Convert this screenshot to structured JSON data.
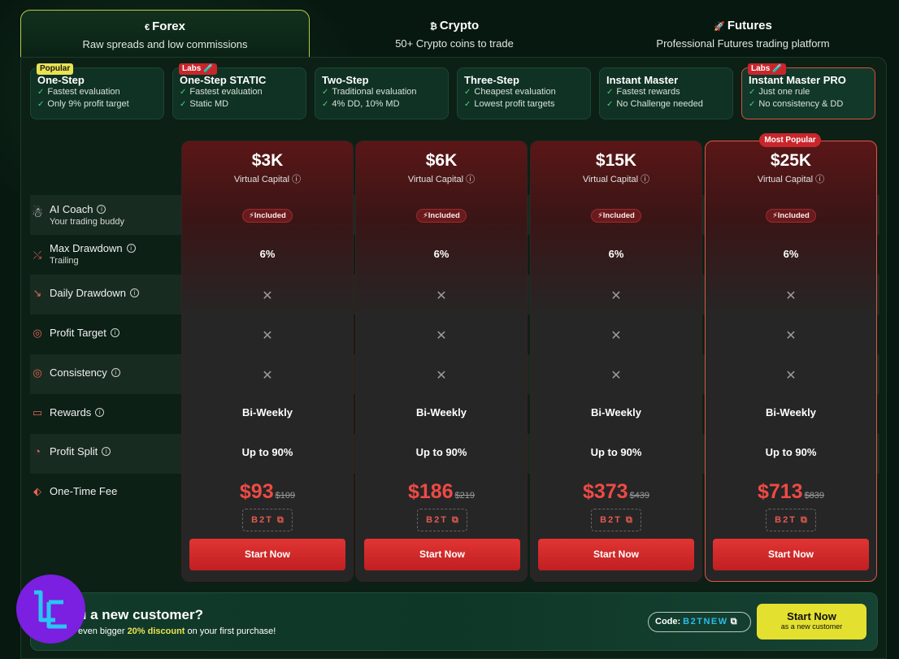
{
  "markets": [
    {
      "icon": "€",
      "name": "Forex",
      "desc": "Raw spreads and low commissions"
    },
    {
      "icon": "₿",
      "name": "Crypto",
      "desc": "50+ Crypto coins to trade"
    },
    {
      "icon": "🚀",
      "name": "Futures",
      "desc": "Professional Futures trading platform"
    }
  ],
  "programs": [
    {
      "name": "One-Step",
      "badge": "Popular",
      "features": [
        "Fastest evaluation",
        "Only 9% profit target"
      ]
    },
    {
      "name": "One-Step STATIC",
      "badge": "Labs 🧪",
      "features": [
        "Fastest evaluation",
        "Static MD"
      ]
    },
    {
      "name": "Two-Step",
      "badge": "",
      "features": [
        "Traditional evaluation",
        "4% DD, 10% MD"
      ]
    },
    {
      "name": "Three-Step",
      "badge": "",
      "features": [
        "Cheapest evaluation",
        "Lowest profit targets"
      ]
    },
    {
      "name": "Instant Master",
      "badge": "",
      "features": [
        "Fastest rewards",
        "No Challenge needed"
      ]
    },
    {
      "name": "Instant Master PRO",
      "badge": "Labs 🧪",
      "features": [
        "Just one rule",
        "No consistency & DD"
      ]
    }
  ],
  "rows": {
    "ai_coach": "AI Coach",
    "ai_coach_sub": "Your trading buddy",
    "max_dd": "Max Drawdown",
    "max_dd_sub": "Trailing",
    "daily_dd": "Daily Drawdown",
    "profit_target": "Profit Target",
    "consistency": "Consistency",
    "rewards": "Rewards",
    "profit_split": "Profit Split",
    "fee": "One-Time Fee"
  },
  "plans": [
    {
      "capital": "$3K",
      "capital_label": "Virtual Capital",
      "ai": "Included",
      "max_dd": "6%",
      "daily": "✕",
      "target": "✕",
      "consistency": "✕",
      "rewards": "Bi-Weekly",
      "split": "Up to 90%",
      "price": "$93",
      "old": "$109",
      "code": "B2T",
      "cta": "Start Now"
    },
    {
      "capital": "$6K",
      "capital_label": "Virtual Capital",
      "ai": "Included",
      "max_dd": "6%",
      "daily": "✕",
      "target": "✕",
      "consistency": "✕",
      "rewards": "Bi-Weekly",
      "split": "Up to 90%",
      "price": "$186",
      "old": "$219",
      "code": "B2T",
      "cta": "Start Now"
    },
    {
      "capital": "$15K",
      "capital_label": "Virtual Capital",
      "ai": "Included",
      "max_dd": "6%",
      "daily": "✕",
      "target": "✕",
      "consistency": "✕",
      "rewards": "Bi-Weekly",
      "split": "Up to 90%",
      "price": "$373",
      "old": "$439",
      "code": "B2T",
      "cta": "Start Now"
    },
    {
      "capital": "$25K",
      "capital_label": "Virtual Capital",
      "ai": "Included",
      "max_dd": "6%",
      "daily": "✕",
      "target": "✕",
      "consistency": "✕",
      "rewards": "Bi-Weekly",
      "split": "Up to 90%",
      "price": "$713",
      "old": "$839",
      "code": "B2T",
      "cta": "Start Now"
    }
  ],
  "most_popular": "Most Popular",
  "banner": {
    "question": "u a new customer?",
    "desc_pre": "even bigger",
    "desc_hl": "20% discount",
    "desc_post": "on your first purchase!",
    "code_label": "Code:",
    "code_value": "B2TNEW",
    "cta": "Start Now",
    "cta_sub": "as a new customer"
  },
  "colors": {
    "accent_red": "#ef4a45",
    "accent_yellow": "#e3e030",
    "bg": "#071810"
  }
}
